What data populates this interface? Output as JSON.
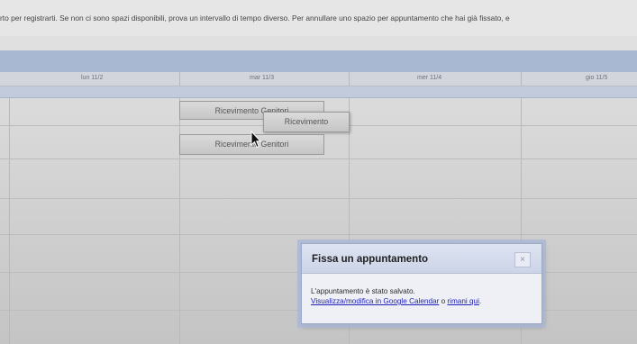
{
  "instructions": "rto per registrarti. Se non ci sono spazi disponibili, prova un intervallo di tempo diverso. Per annullare uno spazio per appuntamento che hai già fissato, e",
  "calendar": {
    "days": [
      "lun 11/2",
      "mar 11/3",
      "mer 11/4",
      "gio 11/5"
    ]
  },
  "slots": {
    "slot_1": "Ricevimento Genitori",
    "slot_2": "Ricevimento",
    "slot_3": "Ricevimento Genitori"
  },
  "dialog": {
    "title": "Fissa un appuntamento",
    "close": "×",
    "message": "L'appuntamento è stato salvato.",
    "link_calendar": "Visualizza/modifica in Google Calendar",
    "separator": " o ",
    "link_stay": "rimani qui",
    "end": "."
  }
}
